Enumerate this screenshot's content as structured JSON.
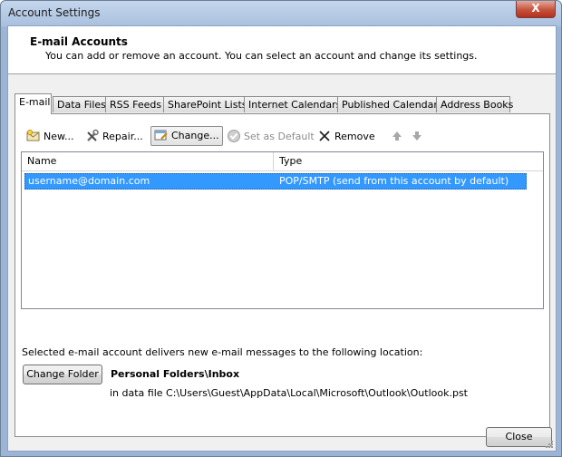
{
  "window": {
    "title": "Account Settings",
    "close_glyph": "X"
  },
  "header": {
    "title": "E-mail Accounts",
    "description": "You can add or remove an account. You can select an account and change its settings."
  },
  "tabs": [
    {
      "label": "E-mail",
      "active": true
    },
    {
      "label": "Data Files"
    },
    {
      "label": "RSS Feeds"
    },
    {
      "label": "SharePoint Lists"
    },
    {
      "label": "Internet Calendars"
    },
    {
      "label": "Published Calendars"
    },
    {
      "label": "Address Books"
    }
  ],
  "toolbar": {
    "new_label": "New...",
    "repair_label": "Repair...",
    "change_label": "Change...",
    "set_default_label": "Set as Default",
    "remove_label": "Remove"
  },
  "accounts_list": {
    "columns": [
      "Name",
      "Type"
    ],
    "rows": [
      {
        "name": "username@domain.com",
        "type": "POP/SMTP (send from this account by default)",
        "selected": true
      }
    ]
  },
  "delivery": {
    "description": "Selected e-mail account delivers new e-mail messages to the following location:",
    "change_folder_label": "Change Folder",
    "folder_name": "Personal Folders\\Inbox",
    "folder_path": "in data file C:\\Users\\Guest\\AppData\\Local\\Microsoft\\Outlook\\Outlook.pst"
  },
  "footer": {
    "close_label": "Close"
  },
  "colors": {
    "selection": "#3399ff",
    "frame": "#a9c0de",
    "close_button": "#c5533c"
  }
}
